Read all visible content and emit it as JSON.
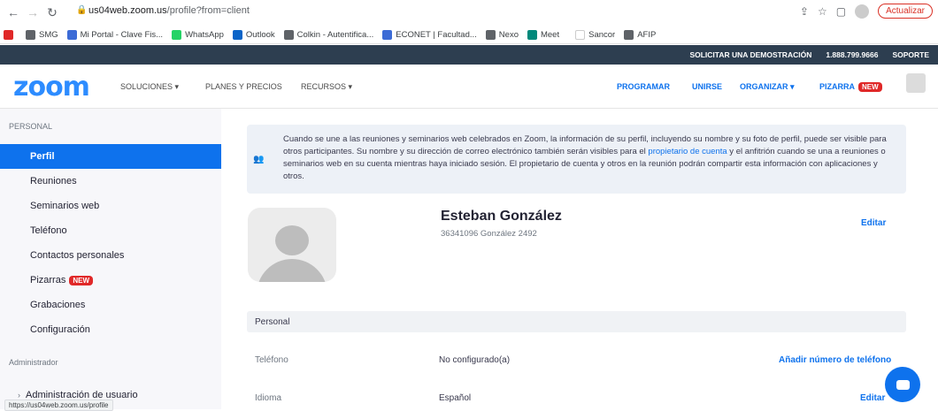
{
  "browser": {
    "url_host": "us04web.zoom.us",
    "url_path": "/profile?from=client",
    "update_label": "Actualizar",
    "bookmarks": [
      {
        "label": "",
        "color": "#e02828"
      },
      {
        "label": "SMG",
        "color": "#5f6368"
      },
      {
        "label": "Mi Portal - Clave Fis...",
        "color": "#3c6bd6"
      },
      {
        "label": "WhatsApp",
        "color": "#25d366"
      },
      {
        "label": "Outlook",
        "color": "#0a64c8"
      },
      {
        "label": "Colkin - Autentifica...",
        "color": "#5f6368"
      },
      {
        "label": "ECONET | Facultad...",
        "color": "#3c6bd6"
      },
      {
        "label": "Nexo",
        "color": "#5f6368"
      },
      {
        "label": "Meet",
        "color": "#00897b"
      },
      {
        "label": "Sancor",
        "color": "#ffffff"
      },
      {
        "label": "AFIP",
        "color": "#5f6368"
      }
    ],
    "status_url": "https://us04web.zoom.us/profile"
  },
  "topbar": {
    "demo": "SOLICITAR UNA DEMOSTRACIÓN",
    "phone": "1.888.799.9666",
    "support": "SOPORTE"
  },
  "header": {
    "logo": "zoom",
    "nav_left": [
      "SOLUCIONES ▾",
      "PLANES Y PRECIOS",
      "RECURSOS ▾"
    ],
    "nav_right": {
      "schedule": "PROGRAMAR",
      "join": "UNIRSE",
      "host": "ORGANIZAR ▾",
      "whiteboard": "PIZARRA",
      "new_badge": "NEW"
    }
  },
  "sidebar": {
    "section_personal": "PERSONAL",
    "items": [
      {
        "label": "Perfil",
        "active": true
      },
      {
        "label": "Reuniones"
      },
      {
        "label": "Seminarios web"
      },
      {
        "label": "Teléfono"
      },
      {
        "label": "Contactos personales"
      },
      {
        "label": "Pizarras",
        "badge": "NEW"
      },
      {
        "label": "Grabaciones"
      },
      {
        "label": "Configuración"
      }
    ],
    "section_admin": "Administrador",
    "admin_items": [
      {
        "label": "Administración de usuario"
      }
    ]
  },
  "notice": {
    "text_1": "Cuando se une a las reuniones y seminarios web celebrados en Zoom, la información de su perfil, incluyendo su nombre y su foto de perfil, puede ser visible para otros participantes. Su nombre y su dirección de correo electrónico también serán visibles para el ",
    "link": "propietario de cuenta",
    "text_2": " y el anfitrión cuando se una a reuniones o seminarios web en su cuenta mientras haya iniciado sesión. El propietario de cuenta y otros en la reunión podrán compartir esta información con aplicaciones y otros."
  },
  "profile": {
    "name": "Esteban González",
    "subline": "36341096 González 2492",
    "edit": "Editar"
  },
  "personal": {
    "section_title": "Personal",
    "phone_label": "Teléfono",
    "phone_value": "No configurado(a)",
    "phone_action": "Añadir número de teléfono",
    "language_label": "Idioma",
    "language_value": "Español",
    "language_action": "Editar"
  }
}
